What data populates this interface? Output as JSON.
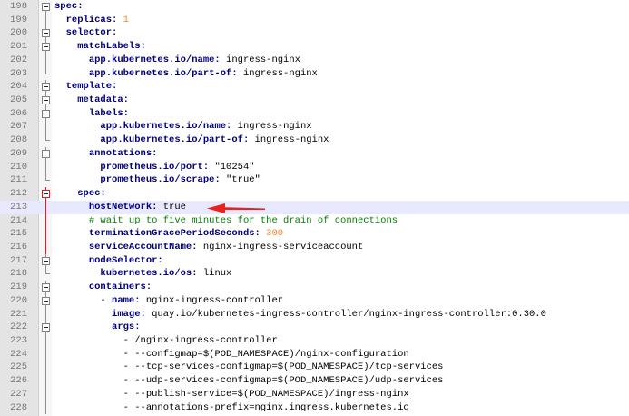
{
  "colors": {
    "key": "#000080",
    "number": "#ff7f27",
    "comment": "#008000",
    "highlight": "#e8e8ff",
    "arrow": "#e8231e"
  },
  "lines": [
    {
      "n": "198",
      "indent": "",
      "key": "spec:",
      "val": "",
      "type": "kv",
      "fold": "box"
    },
    {
      "n": "199",
      "indent": "  ",
      "key": "replicas:",
      "val": " 1",
      "type": "num",
      "fold": "line"
    },
    {
      "n": "200",
      "indent": "  ",
      "key": "selector:",
      "val": "",
      "type": "kv",
      "fold": "box"
    },
    {
      "n": "201",
      "indent": "    ",
      "key": "matchLabels:",
      "val": "",
      "type": "kv",
      "fold": "box"
    },
    {
      "n": "202",
      "indent": "      ",
      "key": "app.kubernetes.io/name:",
      "val": " ingress-nginx",
      "type": "kv",
      "fold": "line"
    },
    {
      "n": "203",
      "indent": "      ",
      "key": "app.kubernetes.io/part-of:",
      "val": " ingress-nginx",
      "type": "kv",
      "fold": "end"
    },
    {
      "n": "204",
      "indent": "  ",
      "key": "template:",
      "val": "",
      "type": "kv",
      "fold": "box"
    },
    {
      "n": "205",
      "indent": "    ",
      "key": "metadata:",
      "val": "",
      "type": "kv",
      "fold": "box"
    },
    {
      "n": "206",
      "indent": "      ",
      "key": "labels:",
      "val": "",
      "type": "kv",
      "fold": "box"
    },
    {
      "n": "207",
      "indent": "        ",
      "key": "app.kubernetes.io/name:",
      "val": " ingress-nginx",
      "type": "kv",
      "fold": "line"
    },
    {
      "n": "208",
      "indent": "        ",
      "key": "app.kubernetes.io/part-of:",
      "val": " ingress-nginx",
      "type": "kv",
      "fold": "end"
    },
    {
      "n": "209",
      "indent": "      ",
      "key": "annotations:",
      "val": "",
      "type": "kv",
      "fold": "box"
    },
    {
      "n": "210",
      "indent": "        ",
      "key": "prometheus.io/port:",
      "val": " \"10254\"",
      "type": "kv",
      "fold": "line"
    },
    {
      "n": "211",
      "indent": "        ",
      "key": "prometheus.io/scrape:",
      "val": " \"true\"",
      "type": "kv",
      "fold": "end"
    },
    {
      "n": "212",
      "indent": "    ",
      "key": "spec:",
      "val": "",
      "type": "kv",
      "fold": "redbox"
    },
    {
      "n": "213",
      "indent": "      ",
      "key": "hostNetwork:",
      "val": " true",
      "type": "kv",
      "fold": "redline",
      "highlight": true
    },
    {
      "n": "214",
      "indent": "      ",
      "key": "",
      "val": "# wait up to five minutes for the drain of connections",
      "type": "comment",
      "fold": "redline"
    },
    {
      "n": "215",
      "indent": "      ",
      "key": "terminationGracePeriodSeconds:",
      "val": " 300",
      "type": "num",
      "fold": "redline"
    },
    {
      "n": "216",
      "indent": "      ",
      "key": "serviceAccountName:",
      "val": " nginx-ingress-serviceaccount",
      "type": "kv",
      "fold": "redline"
    },
    {
      "n": "217",
      "indent": "      ",
      "key": "nodeSelector:",
      "val": "",
      "type": "kv",
      "fold": "box"
    },
    {
      "n": "218",
      "indent": "        ",
      "key": "kubernetes.io/os:",
      "val": " linux",
      "type": "kv",
      "fold": "end"
    },
    {
      "n": "219",
      "indent": "      ",
      "key": "containers:",
      "val": "",
      "type": "kv",
      "fold": "box"
    },
    {
      "n": "220",
      "indent": "        - ",
      "key": "name:",
      "val": " nginx-ingress-controller",
      "type": "kv",
      "fold": "box"
    },
    {
      "n": "221",
      "indent": "          ",
      "key": "image:",
      "val": " quay.io/kubernetes-ingress-controller/nginx-ingress-controller:0.30.0",
      "type": "kv",
      "fold": "line"
    },
    {
      "n": "222",
      "indent": "          ",
      "key": "args:",
      "val": "",
      "type": "kv",
      "fold": "box"
    },
    {
      "n": "223",
      "indent": "            ",
      "key": "",
      "val": "- /nginx-ingress-controller",
      "type": "plain",
      "fold": "line"
    },
    {
      "n": "224",
      "indent": "            ",
      "key": "",
      "val": "- --configmap=$(POD_NAMESPACE)/nginx-configuration",
      "type": "plain",
      "fold": "line"
    },
    {
      "n": "225",
      "indent": "            ",
      "key": "",
      "val": "- --tcp-services-configmap=$(POD_NAMESPACE)/tcp-services",
      "type": "plain",
      "fold": "line"
    },
    {
      "n": "226",
      "indent": "            ",
      "key": "",
      "val": "- --udp-services-configmap=$(POD_NAMESPACE)/udp-services",
      "type": "plain",
      "fold": "line"
    },
    {
      "n": "227",
      "indent": "            ",
      "key": "",
      "val": "- --publish-service=$(POD_NAMESPACE)/ingress-nginx",
      "type": "plain",
      "fold": "line"
    },
    {
      "n": "228",
      "indent": "            ",
      "key": "",
      "val": "- --annotations-prefix=nginx.ingress.kubernetes.io",
      "type": "plain",
      "fold": "line"
    }
  ]
}
